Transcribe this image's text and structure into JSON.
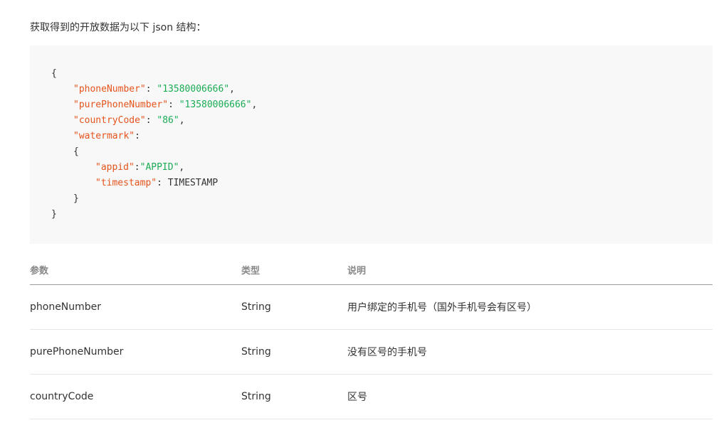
{
  "intro_text": "获取得到的开放数据为以下 json 结构：",
  "code": {
    "open_brace": "{",
    "close_brace": "}",
    "fields": [
      {
        "key": "\"phoneNumber\"",
        "sep": ": ",
        "value": "\"13580006666\"",
        "tail": ","
      },
      {
        "key": "\"purePhoneNumber\"",
        "sep": ": ",
        "value": "\"13580006666\"",
        "tail": ","
      },
      {
        "key": "\"countryCode\"",
        "sep": ": ",
        "value": "\"86\"",
        "tail": ","
      },
      {
        "key": "\"watermark\"",
        "sep": ":",
        "value": "",
        "tail": ""
      }
    ],
    "inner_open": "{",
    "inner_close": "}",
    "inner_fields": [
      {
        "key": "\"appid\"",
        "sep": ":",
        "value": "\"APPID\"",
        "tail": ","
      },
      {
        "key": "\"timestamp\"",
        "sep": ": ",
        "value": "TIMESTAMP",
        "tail": ""
      }
    ]
  },
  "table": {
    "headers": [
      "参数",
      "类型",
      "说明"
    ],
    "rows": [
      {
        "name": "phoneNumber",
        "type": "String",
        "desc": "用户绑定的手机号（国外手机号会有区号）"
      },
      {
        "name": "purePhoneNumber",
        "type": "String",
        "desc": "没有区号的手机号"
      },
      {
        "name": "countryCode",
        "type": "String",
        "desc": "区号"
      }
    ]
  },
  "colors": {
    "key": "#e5541c",
    "string": "#1aac55",
    "code_bg": "#f8f8f8",
    "text": "#333333",
    "header_text": "#888888"
  }
}
